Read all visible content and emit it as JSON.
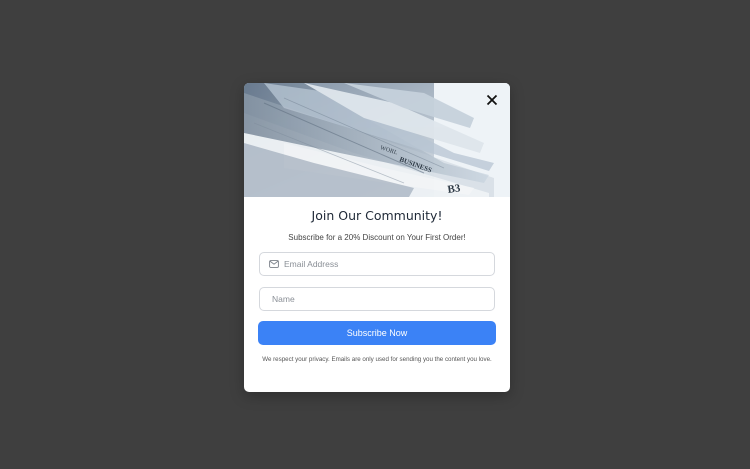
{
  "popup": {
    "hero_image": "newspapers",
    "hero_text": {
      "word1": "WORL",
      "word2": "BUSINESS",
      "number": "B3"
    },
    "close_icon": "close-icon",
    "title": "Join Our Community!",
    "subtitle": "Subscribe for a 20% Discount on Your First Order!",
    "email": {
      "icon": "mail-icon",
      "placeholder": "Email Address",
      "value": ""
    },
    "name": {
      "placeholder": "Name",
      "value": ""
    },
    "subscribe_label": "Subscribe Now",
    "privacy_text": "We respect your privacy. Emails are only used for sending you the content you love."
  },
  "colors": {
    "backdrop": "#3f3f3f",
    "modal_bg": "#ffffff",
    "button": "#3b82f6",
    "button_text": "#ffffff",
    "field_border": "#d5d8dd"
  }
}
